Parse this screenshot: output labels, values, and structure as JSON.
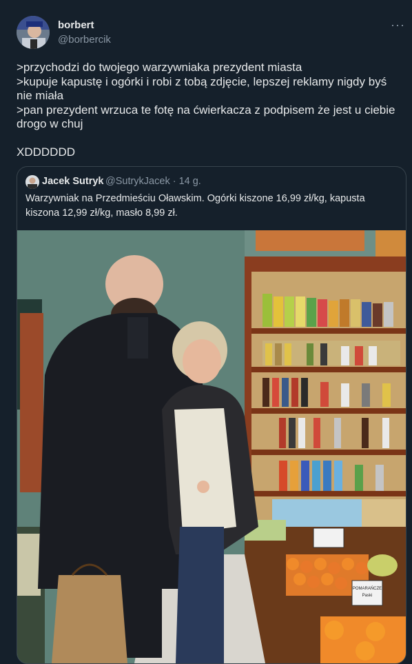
{
  "author": {
    "name": "borbert",
    "handle": "@borbercik"
  },
  "menu_icon": "more-horizontal-icon",
  "tweet": {
    "text": ">przychodzi do twojego warzywniaka prezydent miasta\n>kupuje kapustę i ogórki i robi z tobą zdjęcie, lepszej reklamy nigdy byś nie miała\n>pan prezydent wrzuca te fotę na ćwierkacza z podpisem że jest u ciebie drogo w chuj\n\nXDDDDDD"
  },
  "quoted": {
    "name": "Jacek Sutryk",
    "handle": "@SutrykJacek · 14 g.",
    "text": "Warzywniak na Przedmieściu Oławskim. Ogórki kiszone 16,99 zł/kg, kapusta kiszona 12,99 zł/kg, masło 8,99 zł.",
    "photo": {
      "sign_1": "POMARAŃCZE",
      "sign_2": "Paski"
    }
  },
  "colors": {
    "background": "#15202b",
    "text": "#e7e9ea",
    "secondary": "#8b98a5",
    "border": "#38444d"
  }
}
